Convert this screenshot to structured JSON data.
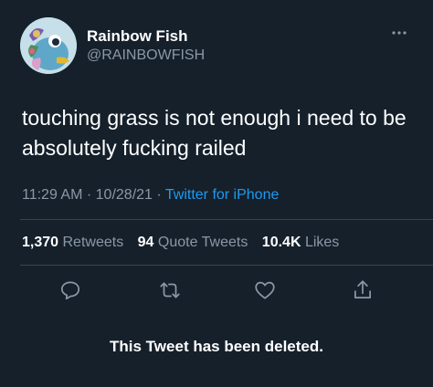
{
  "author": {
    "display_name": "Rainbow Fish",
    "handle": "@RAINBOWFISH",
    "avatar_icon": "rainbow-fish-avatar"
  },
  "tweet": {
    "text": "touching grass is not enough i need to be absolutely fucking railed",
    "time": "11:29 AM",
    "date": "10/28/21",
    "separator": "·",
    "source": "Twitter for iPhone"
  },
  "stats": {
    "retweets_count": "1,370",
    "retweets_label": "Retweets",
    "quotes_count": "94",
    "quotes_label": "Quote Tweets",
    "likes_count": "10.4K",
    "likes_label": "Likes"
  },
  "actions": {
    "reply_icon": "comment-icon",
    "retweet_icon": "retweet-icon",
    "like_icon": "heart-icon",
    "share_icon": "share-icon",
    "more_icon": "more-dots-icon"
  },
  "notice": {
    "deleted_text": "This Tweet has been deleted."
  },
  "colors": {
    "background": "#15202b",
    "primary_text": "#ffffff",
    "secondary_text": "#8b98a5",
    "accent": "#1d9bf0",
    "divider": "#38444d"
  }
}
